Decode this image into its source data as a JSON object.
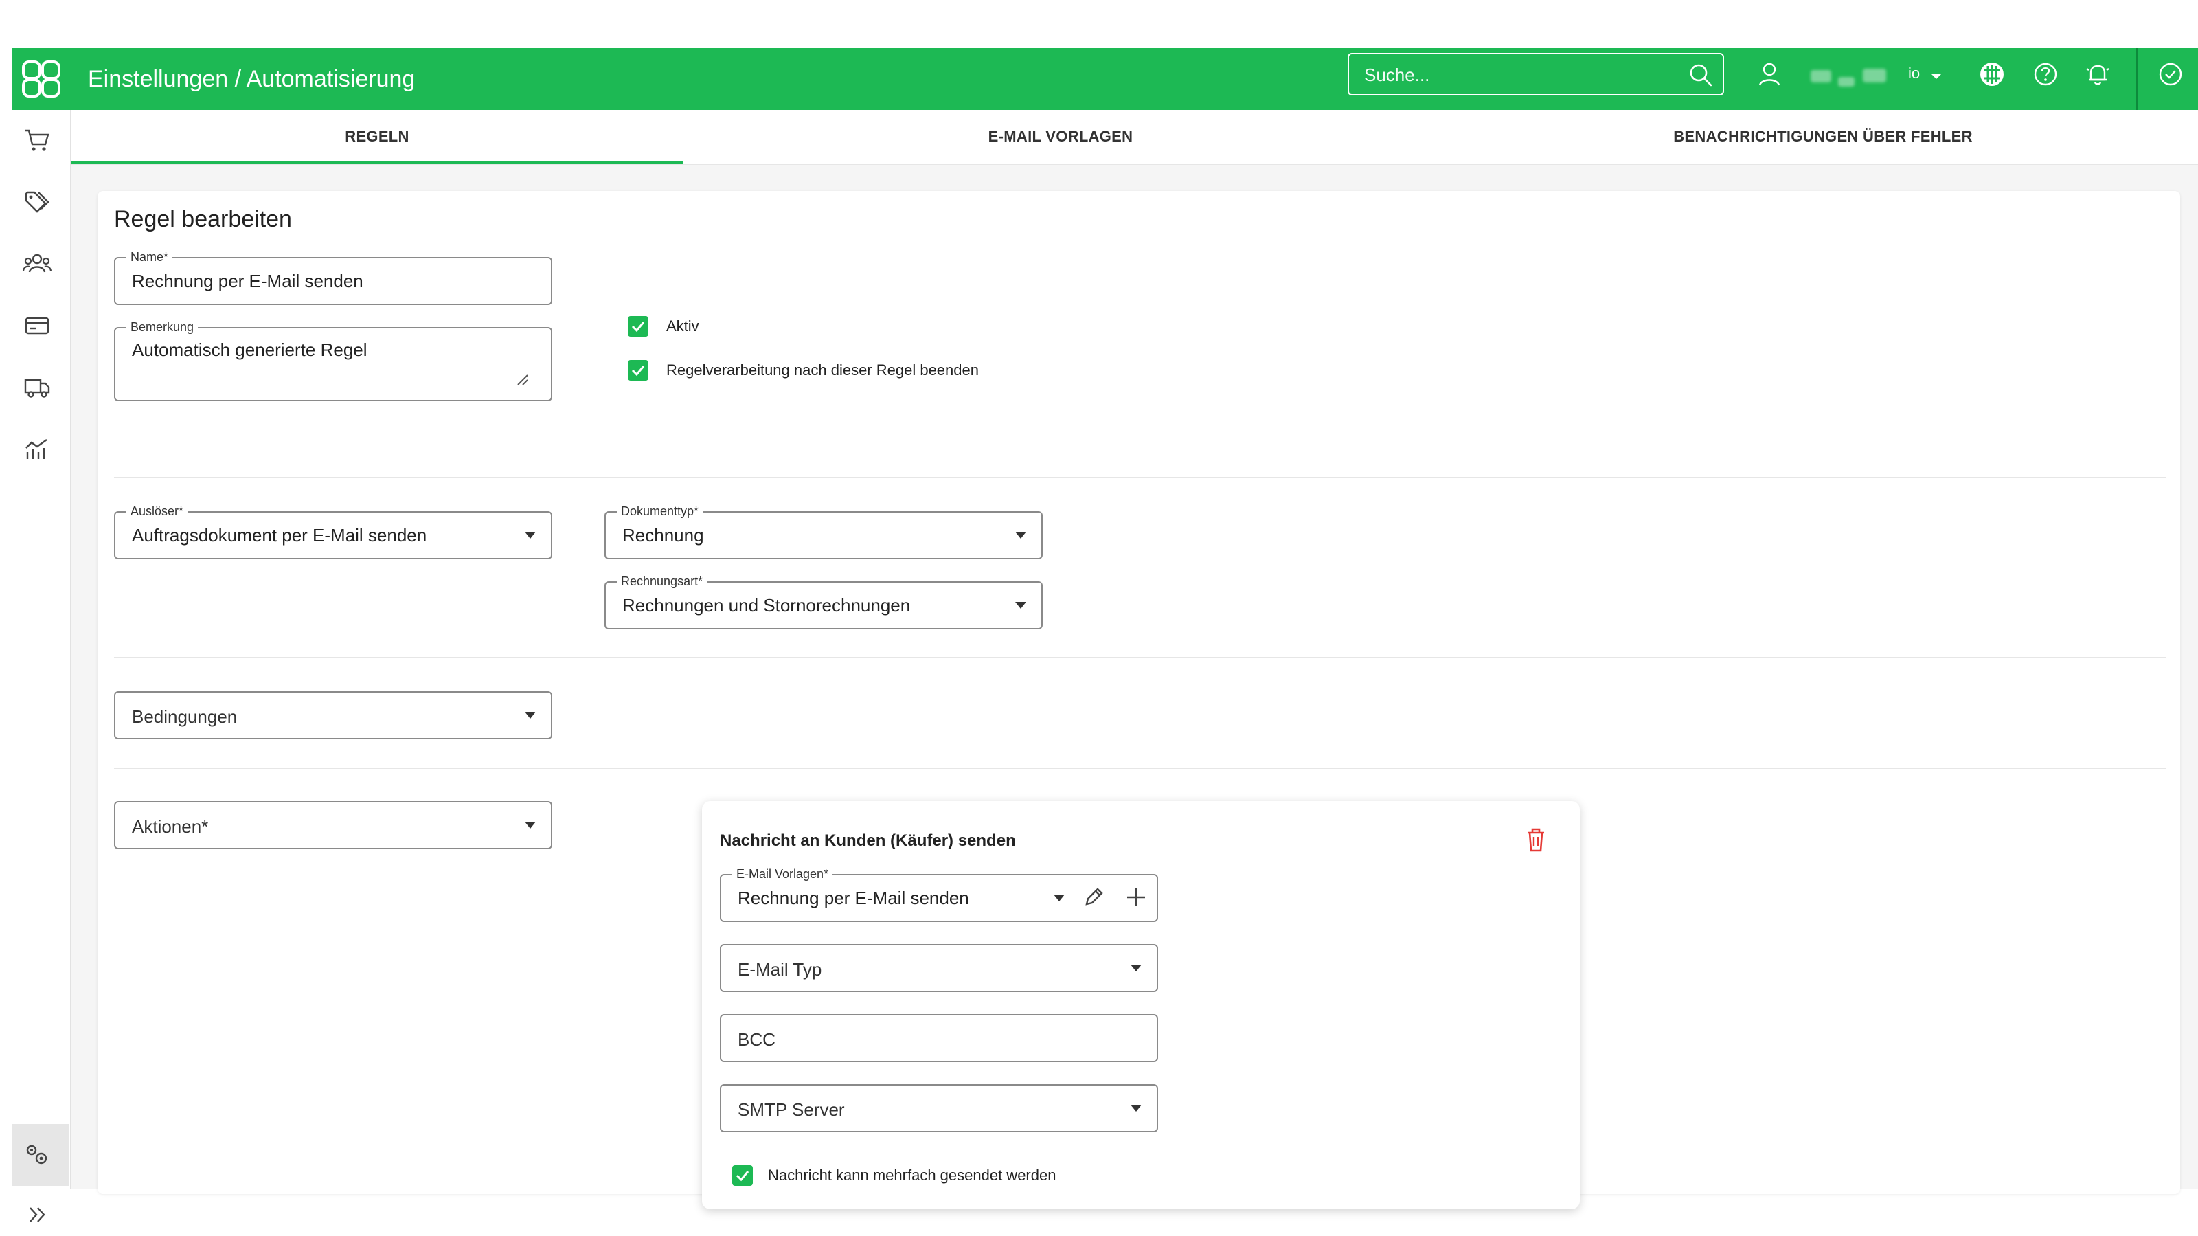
{
  "header": {
    "title": "Einstellungen / Automatisierung",
    "search_placeholder": "Suche...",
    "user_short": "io",
    "brand_color": "#1db954"
  },
  "sidebar": {
    "items": [
      "cart-icon",
      "tags-icon",
      "users-icon",
      "payment-card-icon",
      "delivery-truck-icon",
      "analytics-icon",
      "settings-gears-icon",
      "expand-chevrons-icon"
    ],
    "active": "settings-gears-icon"
  },
  "tabs": [
    {
      "label": "REGELN",
      "active": true
    },
    {
      "label": "E-MAIL VORLAGEN",
      "active": false
    },
    {
      "label": "BENACHRICHTIGUNGEN ÜBER FEHLER",
      "active": false
    }
  ],
  "form": {
    "title": "Regel bearbeiten",
    "name": {
      "label": "Name*",
      "value": "Rechnung per E-Mail senden"
    },
    "bemerkung": {
      "label": "Bemerkung",
      "value": "Automatisch generierte Regel"
    },
    "aktiv": {
      "label": "Aktiv",
      "checked": true
    },
    "stop": {
      "label": "Regelverarbeitung nach dieser Regel beenden",
      "checked": true
    },
    "trigger": {
      "label": "Auslöser*",
      "value": "Auftragsdokument per E-Mail senden"
    },
    "doctype": {
      "label": "Dokumenttyp*",
      "value": "Rechnung"
    },
    "invoicetype": {
      "label": "Rechnungsart*",
      "value": "Rechnungen und Stornorechnungen"
    },
    "conditions": {
      "placeholder": "Bedingungen"
    },
    "actions": {
      "placeholder": "Aktionen*"
    }
  },
  "action_card": {
    "title": "Nachricht an Kunden (Käufer) senden",
    "template": {
      "label": "E-Mail Vorlagen*",
      "value": "Rechnung per E-Mail senden"
    },
    "email_type": {
      "placeholder": "E-Mail Typ"
    },
    "bcc": {
      "placeholder": "BCC"
    },
    "smtp": {
      "placeholder": "SMTP Server"
    },
    "multiple": {
      "label": "Nachricht kann mehrfach gesendet werden",
      "checked": true
    },
    "danger_color": "#e53935"
  }
}
